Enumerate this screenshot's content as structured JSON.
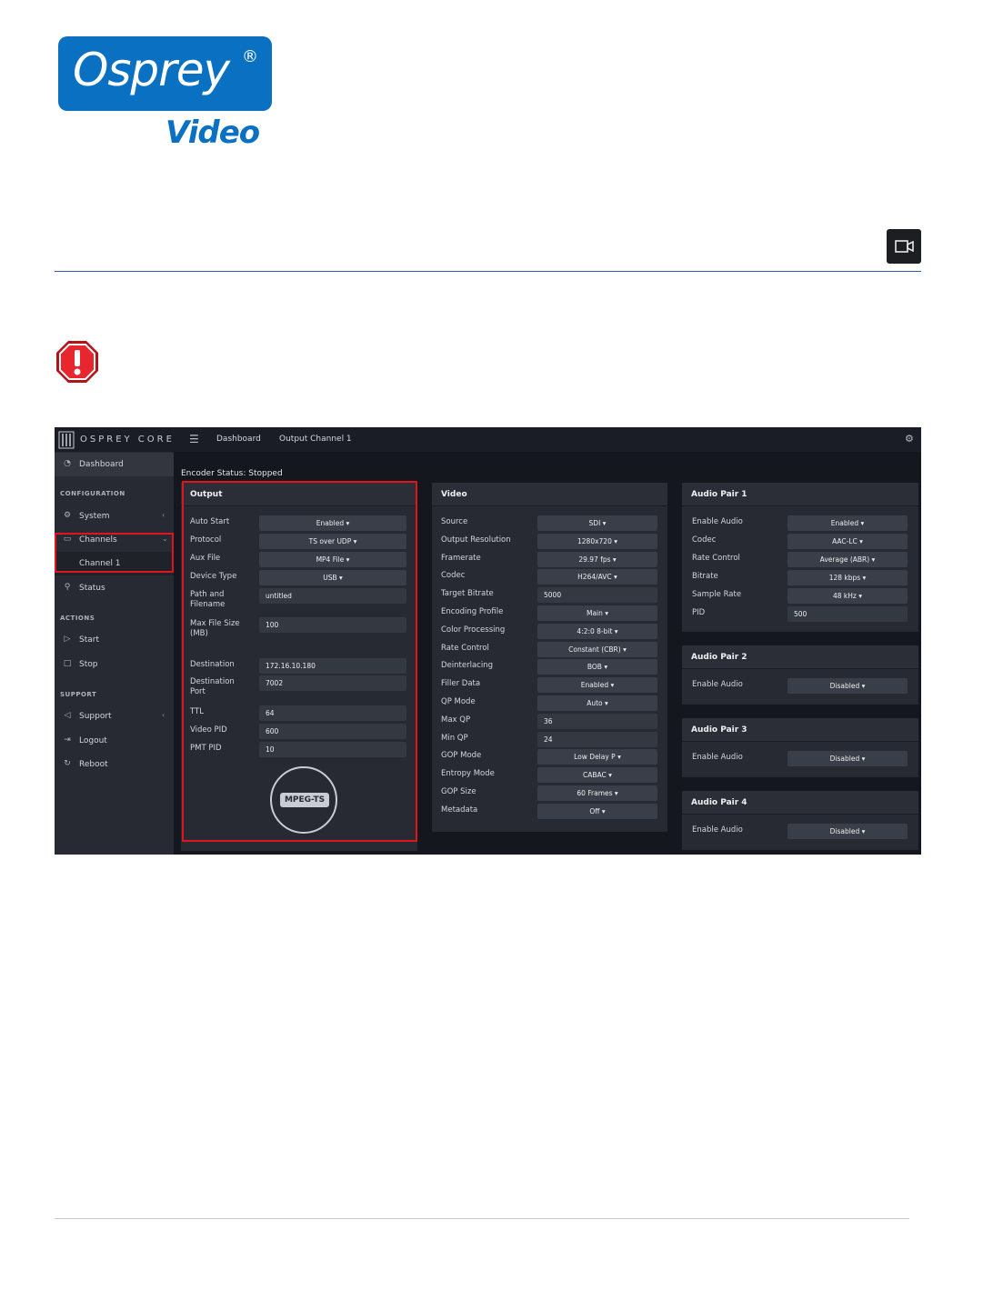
{
  "logo": {
    "brand": "Osprey",
    "reg": "®",
    "sub": "Video"
  },
  "icons": {
    "corner": "video-camera-icon",
    "warning": "warning-octagon-icon"
  },
  "colors": {
    "brand_blue": "#0a71c2",
    "highlight_red": "#e1141b",
    "app_bg": "#14171e",
    "panel_bg": "#272a33"
  },
  "app": {
    "brand": "OSPREY CORE",
    "breadcrumbs": [
      "Dashboard",
      "Output Channel 1"
    ],
    "encoder_status_label": "Encoder Status:",
    "encoder_status_value": "Stopped",
    "sidebar": {
      "dashboard": "Dashboard",
      "configuration_head": "CONFIGURATION",
      "system": "System",
      "channels": "Channels",
      "channel1": "Channel 1",
      "status": "Status",
      "actions_head": "ACTIONS",
      "start": "Start",
      "stop": "Stop",
      "support_head": "SUPPORT",
      "support": "Support",
      "logout": "Logout",
      "reboot": "Reboot"
    },
    "output": {
      "title": "Output",
      "rows": [
        {
          "label": "Auto Start",
          "value": "Enabled ▾",
          "kind": "select"
        },
        {
          "label": "Protocol",
          "value": "TS over UDP ▾",
          "kind": "select"
        },
        {
          "label": "Aux File",
          "value": "MP4 File ▾",
          "kind": "select"
        },
        {
          "label": "Device Type",
          "value": "USB ▾",
          "kind": "select"
        },
        {
          "label": "Path and\nFilename",
          "value": "untitled",
          "kind": "input"
        },
        {
          "label": "Max File Size\n(MB)",
          "value": "100",
          "kind": "input"
        },
        {
          "label": "Destination",
          "value": "172.16.10.180",
          "kind": "input"
        },
        {
          "label": "Destination\nPort",
          "value": "7002",
          "kind": "input"
        },
        {
          "label": "TTL",
          "value": "64",
          "kind": "input"
        },
        {
          "label": "Video PID",
          "value": "600",
          "kind": "input"
        },
        {
          "label": "PMT PID",
          "value": "10",
          "kind": "input"
        }
      ],
      "badge": "MPEG-TS"
    },
    "video": {
      "title": "Video",
      "rows": [
        {
          "label": "Source",
          "value": "SDI ▾",
          "kind": "select"
        },
        {
          "label": "Output Resolution",
          "value": "1280x720 ▾",
          "kind": "select"
        },
        {
          "label": "Framerate",
          "value": "29.97 fps ▾",
          "kind": "select"
        },
        {
          "label": "Codec",
          "value": "H264/AVC ▾",
          "kind": "select"
        },
        {
          "label": "Target Bitrate",
          "value": "5000",
          "kind": "input"
        },
        {
          "label": "Encoding Profile",
          "value": "Main ▾",
          "kind": "select"
        },
        {
          "label": "Color Processing",
          "value": "4:2:0 8-bit ▾",
          "kind": "select"
        },
        {
          "label": "Rate Control",
          "value": "Constant (CBR) ▾",
          "kind": "select"
        },
        {
          "label": "Deinterlacing",
          "value": "BOB ▾",
          "kind": "select"
        },
        {
          "label": "Filler Data",
          "value": "Enabled ▾",
          "kind": "select"
        },
        {
          "label": "QP Mode",
          "value": "Auto ▾",
          "kind": "select"
        },
        {
          "label": "Max QP",
          "value": "36",
          "kind": "input"
        },
        {
          "label": "Min QP",
          "value": "24",
          "kind": "input"
        },
        {
          "label": "GOP Mode",
          "value": "Low Delay P ▾",
          "kind": "select"
        },
        {
          "label": "Entropy Mode",
          "value": "CABAC ▾",
          "kind": "select"
        },
        {
          "label": "GOP Size",
          "value": "60 Frames ▾",
          "kind": "select"
        },
        {
          "label": "Metadata",
          "value": "Off ▾",
          "kind": "select"
        }
      ]
    },
    "audio1": {
      "title": "Audio Pair 1",
      "rows": [
        {
          "label": "Enable Audio",
          "value": "Enabled ▾",
          "kind": "select"
        },
        {
          "label": "Codec",
          "value": "AAC-LC ▾",
          "kind": "select"
        },
        {
          "label": "Rate Control",
          "value": "Average (ABR) ▾",
          "kind": "select"
        },
        {
          "label": "Bitrate",
          "value": "128 kbps ▾",
          "kind": "select"
        },
        {
          "label": "Sample Rate",
          "value": "48 kHz ▾",
          "kind": "select"
        },
        {
          "label": "PID",
          "value": "500",
          "kind": "input"
        }
      ]
    },
    "audio2": {
      "title": "Audio Pair 2",
      "rows": [
        {
          "label": "Enable Audio",
          "value": "Disabled ▾",
          "kind": "select"
        }
      ]
    },
    "audio3": {
      "title": "Audio Pair 3",
      "rows": [
        {
          "label": "Enable Audio",
          "value": "Disabled ▾",
          "kind": "select"
        }
      ]
    },
    "audio4": {
      "title": "Audio Pair 4",
      "rows": [
        {
          "label": "Enable Audio",
          "value": "Disabled ▾",
          "kind": "select"
        }
      ]
    }
  }
}
